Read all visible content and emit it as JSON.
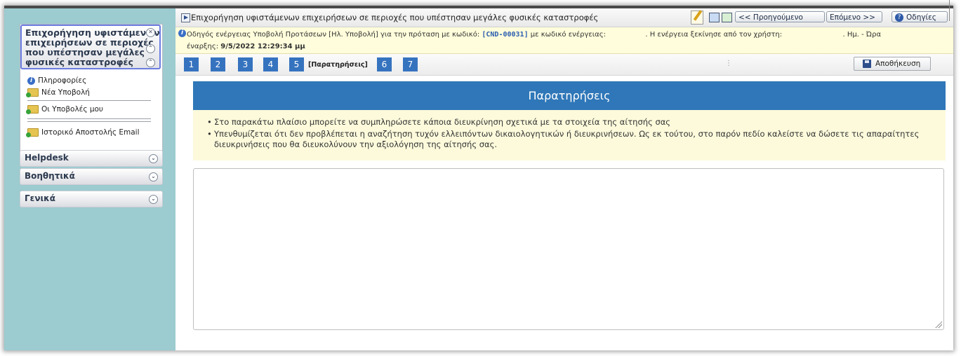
{
  "window": {
    "title": "Επιχορήγηση υφιστάμενων επιχειρήσεων σε περιοχές που υπέστησαν μεγάλες φυσικές καταστροφές"
  },
  "toolbar": {
    "prev_label": "<< Προηγούμενο",
    "next_label": "Επόμενο >>",
    "help_label": "Οδηγίες"
  },
  "sidebar": {
    "main_section_lines": [
      "Επιχορήγηση υφιστάμενων",
      "επιχειρήσεων σε περιοχές",
      "που υπέστησαν μεγάλες",
      "φυσικές καταστροφές"
    ],
    "items": [
      {
        "label": "Πληροφορίες",
        "icon": "info-icon"
      },
      {
        "label": "Νέα Υποβολή",
        "icon": "folder-add-icon"
      },
      {
        "label": "Οι Υποβολές μου",
        "icon": "folder-add-icon"
      },
      {
        "label": "Ιστορικό Αποστολής Email",
        "icon": "folder-add-icon"
      }
    ],
    "sections": [
      {
        "label": "Helpdesk"
      },
      {
        "label": "Βοηθητικά"
      },
      {
        "label": "Γενικά"
      }
    ]
  },
  "infobar": {
    "prefix": "Οδηγός ενέργειας Υποβολή Προτάσεων [Ηλ. Υποβολή] για την πρόταση με κωδικό:",
    "code": "[CND-00031]",
    "mid": "με κωδικό ενέργειας:",
    "user_text": ". Η ενέργεια ξεκίνησε από τον χρήστη:",
    "time_label": ". Ημ. - Ώρα",
    "start_label": "έναρξης:",
    "start_value": "9/5/2022 12:29:34 μμ"
  },
  "steps": {
    "items": [
      "1",
      "2",
      "3",
      "4",
      "5",
      "6",
      "7"
    ],
    "active_label": "[Παρατηρήσεις]",
    "save_label": "Αποθήκευση"
  },
  "panel": {
    "title": "Παρατηρήσεις",
    "bullets": [
      "Στο παρακάτω πλαίσιο μπορείτε να συμπληρώσετε κάποια διευκρίνηση σχετικά με τα στοιχεία της αίτησής σας",
      "Υπενθυμίζεται ότι δεν προβλέπεται η αναζήτηση τυχόν ελλειπόντων δικαιολογητικών ή διευκρινήσεων. Ως εκ τούτου, στο παρόν πεδίο καλείστε να δώσετε τις απαραίτητες",
      "διευκρινήσεις που θα διευκολύνουν την αξιολόγηση της αίτησής σας."
    ],
    "textarea_value": ""
  },
  "colors": {
    "sidebar_bg": "#9ccbd0",
    "accent_blue": "#2f77b8",
    "info_bg": "#fffddb"
  }
}
